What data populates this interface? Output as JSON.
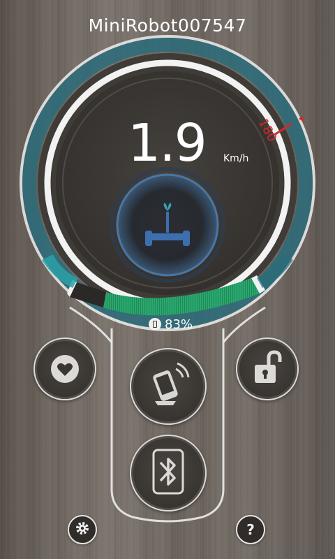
{
  "device": {
    "name": "MiniRobot007547"
  },
  "speedometer": {
    "speed": "1.9",
    "unit": "Km/h",
    "limit_label": "180"
  },
  "battery": {
    "percent_label": "83%",
    "level": 0.83
  },
  "buttons": {
    "favorite": "heart-icon",
    "remote_control": "phone-remote-icon",
    "lock": "unlock-icon",
    "bluetooth": "bluetooth-icon",
    "settings": "gear-icon",
    "help": "help-icon"
  },
  "colors": {
    "accent": "#2aa86e",
    "ring": "#2a6c7a",
    "limit": "#d42a2a",
    "scooter": "#3d6fb0"
  }
}
